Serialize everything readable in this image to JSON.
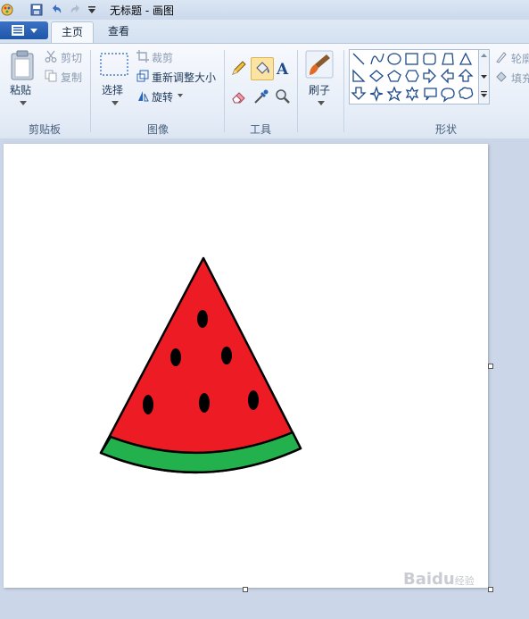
{
  "window": {
    "title": "无标题 - 画图"
  },
  "tabs": [
    {
      "label": "主页",
      "active": true
    },
    {
      "label": "查看",
      "active": false
    }
  ],
  "clipboard": {
    "paste_label": "粘贴",
    "cut_label": "剪切",
    "copy_label": "复制",
    "group_label": "剪贴板"
  },
  "image": {
    "select_label": "选择",
    "crop_label": "裁剪",
    "resize_label": "重新调整大小",
    "rotate_label": "旋转",
    "group_label": "图像"
  },
  "tools": {
    "group_label": "工具"
  },
  "brushes": {
    "label": "刷子"
  },
  "shapes": {
    "outline_label": "轮廓",
    "fill_label": "填充",
    "group_label": "形状"
  },
  "drawing": {
    "subject": "watermelon-slice",
    "colors": {
      "flesh": "#ed1c24",
      "rind": "#22b14c",
      "seeds": "#000000",
      "outline": "#000000"
    }
  },
  "colors": {
    "accent": "#2b64b8",
    "ribbon_bg": "#f3f6fb",
    "canvas_bg": "#ffffff",
    "workspace_bg": "#cbd6e8"
  },
  "watermark": {
    "brand": "Baidu",
    "suffix": "经验"
  }
}
